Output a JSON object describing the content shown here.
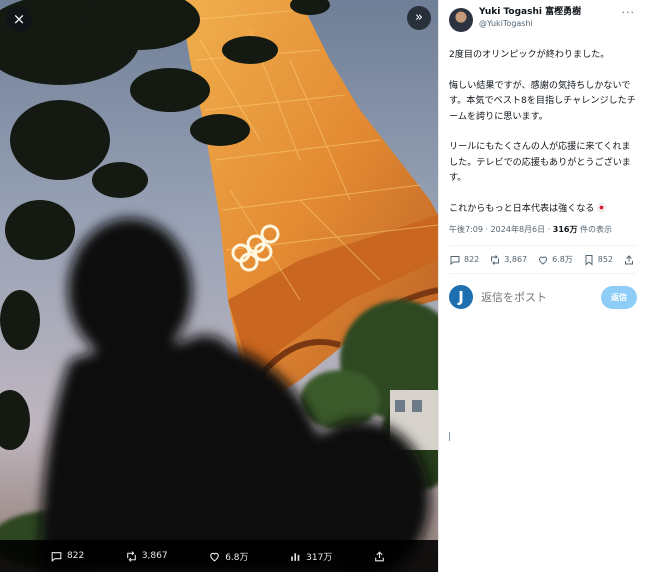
{
  "media": {
    "close_icon": "×",
    "expand_icon": "»",
    "actions": [
      {
        "icon": "reply-icon",
        "count": "822"
      },
      {
        "icon": "retweet-icon",
        "count": "3,867"
      },
      {
        "icon": "like-icon",
        "count": "6.8万"
      },
      {
        "icon": "views-icon",
        "count": "317万"
      },
      {
        "icon": "share-icon",
        "count": ""
      }
    ]
  },
  "tweet": {
    "display_name": "Yuki Togashi 富樫勇樹",
    "handle": "@YukiTogashi",
    "more_icon": "···",
    "paragraphs": [
      "2度目のオリンピックが終わりました。",
      "悔しい結果ですが、感謝の気持ちしかないです。本気でベスト8を目指しチャレンジしたチームを誇りに思います。",
      "リールにもたくさんの人が応援に来てくれました。テレビでの応援もありがとうございます。",
      "これからもっと日本代表は強くなる"
    ],
    "timestamp": "午後7:09 · 2024年8月6日 · ",
    "views_count": "316万",
    "views_label": " 件の表示",
    "actions": [
      {
        "icon": "reply-icon",
        "count": "822"
      },
      {
        "icon": "retweet-icon",
        "count": "3,867"
      },
      {
        "icon": "like-icon",
        "count": "6.8万"
      },
      {
        "icon": "bookmark-icon",
        "count": "852"
      },
      {
        "icon": "share-icon",
        "count": ""
      }
    ]
  },
  "reply": {
    "avatar_letter": "J",
    "placeholder": "返信をポスト",
    "button_label": "返信"
  },
  "colors": {
    "accent": "#1d9bf0",
    "reply_button_disabled": "#8ecdf8",
    "tower_light": "#f0a040",
    "text_secondary": "#536471"
  }
}
